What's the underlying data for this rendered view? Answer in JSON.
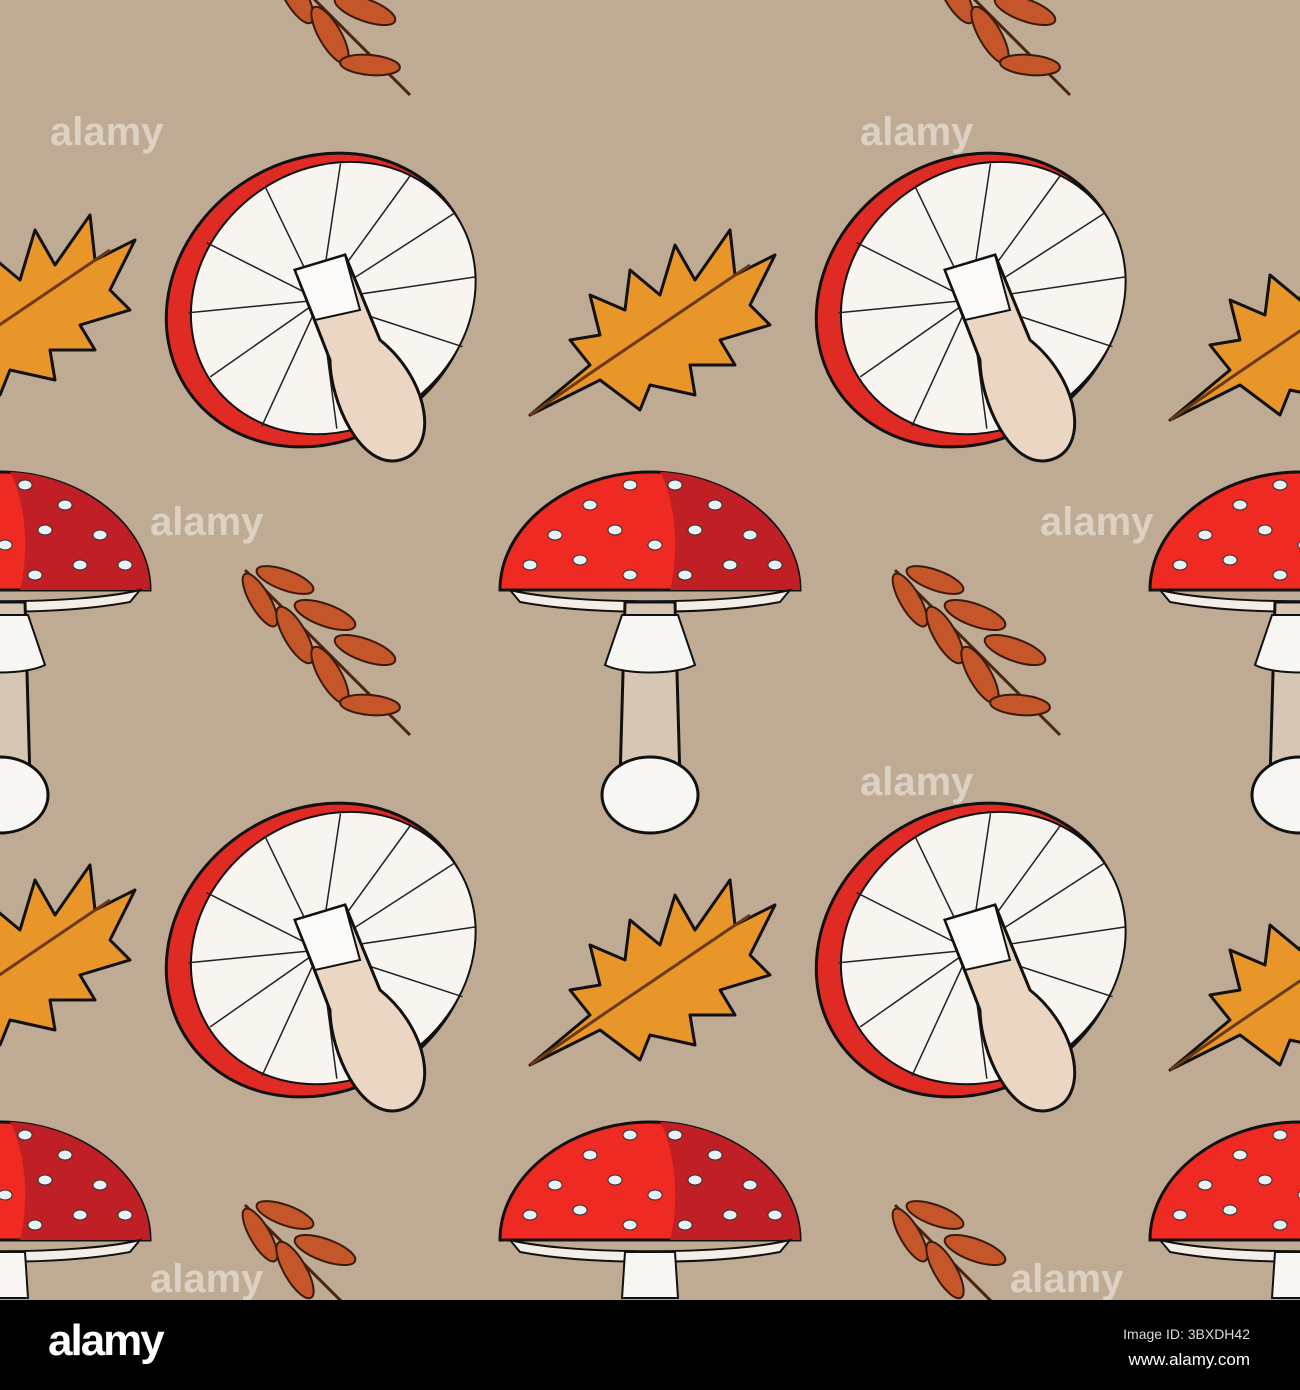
{
  "watermark_text": "alamy",
  "footer": {
    "logo": "alamy",
    "image_id": "Image ID: 3BXDH42",
    "url": "www.alamy.com"
  },
  "colors": {
    "background": "#bfab93",
    "cap_red": "#ee2a22",
    "cap_dark": "#c02025",
    "leaf_orange": "#e8962a",
    "sprig": "#c4562a"
  }
}
